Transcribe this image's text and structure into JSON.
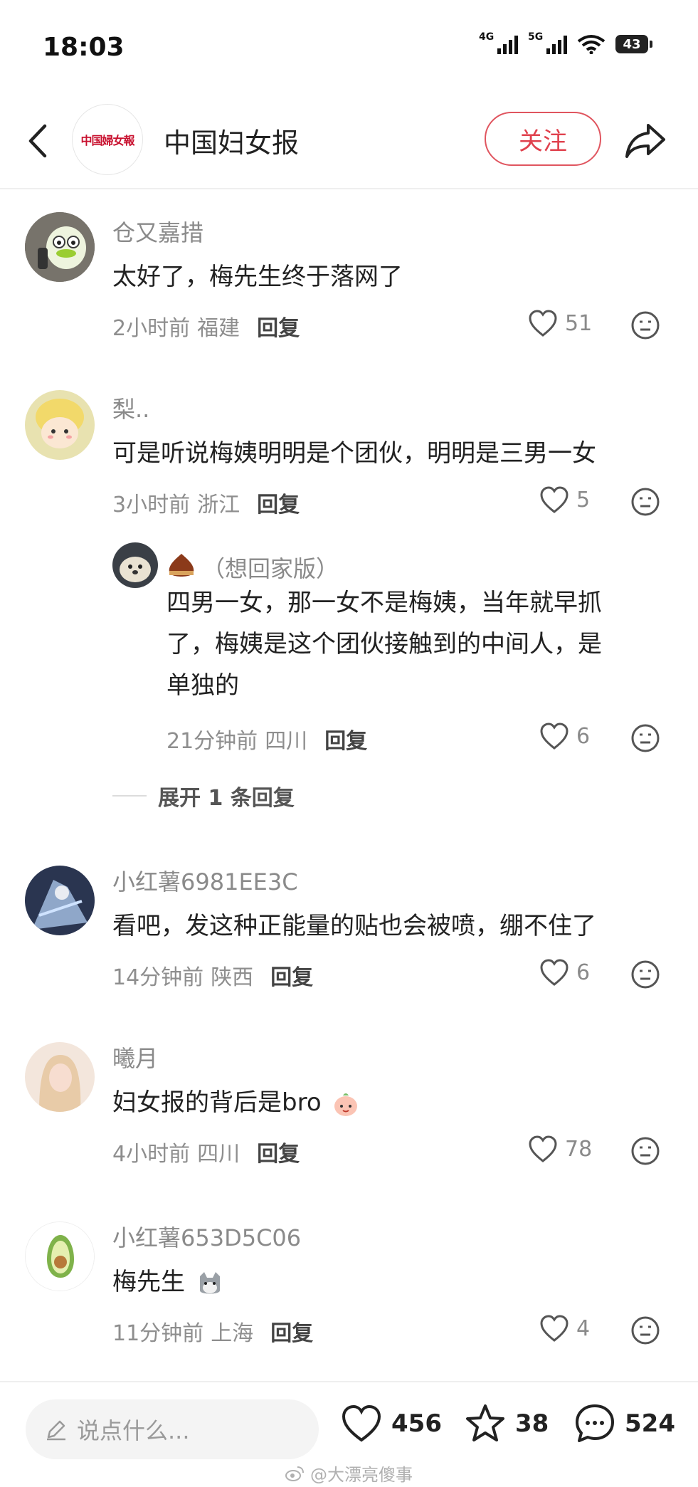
{
  "status_bar": {
    "time": "18:03",
    "signal1_label": "4G",
    "signal2_label": "5G",
    "battery": "43"
  },
  "header": {
    "account_name": "中国妇女报",
    "logo_text": "中国婦女報",
    "follow_label": "关注"
  },
  "comments": [
    {
      "name": "仓又嘉措",
      "text": "太好了，梅先生终于落网了",
      "time": "2小时前",
      "location": "福建",
      "reply_label": "回复",
      "likes": "51"
    },
    {
      "name": "梨..",
      "text": "可是听说梅姨明明是个团伙，明明是三男一女",
      "time": "3小时前",
      "location": "浙江",
      "reply_label": "回复",
      "likes": "5",
      "sub_reply": {
        "name": "（想回家版）",
        "text_lines": [
          "四男一女，那一女不是梅姨，当年就早抓",
          "了，梅姨是这个团伙接触到的中间人，是",
          "单独的"
        ],
        "time": "21分钟前",
        "location": "四川",
        "reply_label": "回复",
        "likes": "6"
      },
      "expand_label": "展开 1 条回复"
    },
    {
      "name": "小红薯6981EE3C",
      "text": "看吧，发这种正能量的贴也会被喷，绷不住了",
      "time": "14分钟前",
      "location": "陕西",
      "reply_label": "回复",
      "likes": "6"
    },
    {
      "name": "曦月",
      "text": "妇女报的背后是bro",
      "time": "4小时前",
      "location": "四川",
      "reply_label": "回复",
      "likes": "78"
    },
    {
      "name": "小红薯653D5C06",
      "text": "梅先生",
      "time": "11分钟前",
      "location": "上海",
      "reply_label": "回复",
      "likes": "4"
    }
  ],
  "bottom_bar": {
    "input_placeholder": "说点什么...",
    "likes_count": "456",
    "favorites_count": "38",
    "comments_count": "524",
    "watermark": "@大漂亮傻事"
  },
  "colors": {
    "accent": "#e0414d",
    "muted": "#8a8a8a"
  }
}
